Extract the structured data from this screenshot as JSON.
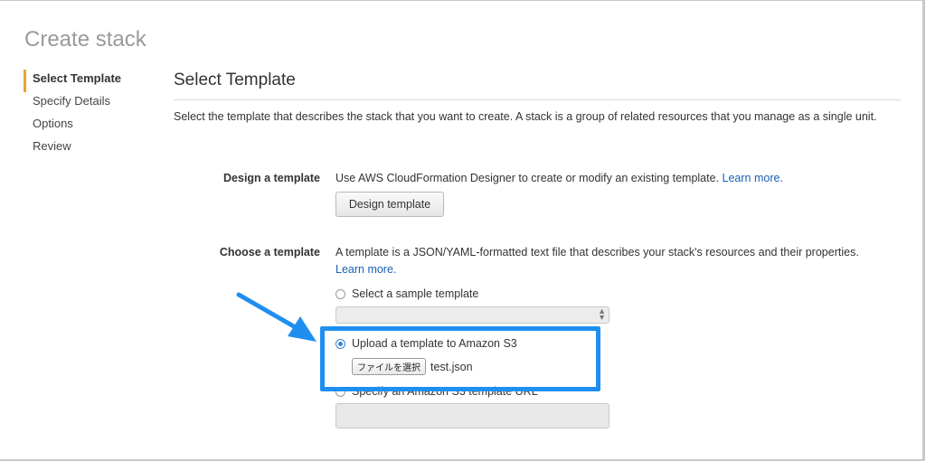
{
  "page": {
    "title": "Create stack"
  },
  "wizard": {
    "steps": [
      {
        "label": "Select Template",
        "active": true
      },
      {
        "label": "Specify Details",
        "active": false
      },
      {
        "label": "Options",
        "active": false
      },
      {
        "label": "Review",
        "active": false
      }
    ]
  },
  "main": {
    "section_title": "Select Template",
    "intro": "Select the template that describes the stack that you want to create. A stack is a group of related resources that you manage as a single unit.",
    "design": {
      "label": "Design a template",
      "text": "Use AWS CloudFormation Designer to create or modify an existing template.",
      "learn_more": "Learn more.",
      "button": "Design template"
    },
    "choose": {
      "label": "Choose a template",
      "text": "A template is a JSON/YAML-formatted text file that describes your stack's resources and their properties.",
      "learn_more": "Learn more.",
      "options": {
        "sample": {
          "label": "Select a sample template",
          "checked": false,
          "select_value": ""
        },
        "upload": {
          "label": "Upload a template to Amazon S3",
          "checked": true,
          "file_button": "ファイルを選択",
          "file_name": "test.json"
        },
        "url": {
          "label": "Specify an Amazon S3 template URL",
          "checked": false,
          "input_value": ""
        }
      }
    }
  },
  "annotation": {
    "highlight_color": "#1e8ff0"
  }
}
